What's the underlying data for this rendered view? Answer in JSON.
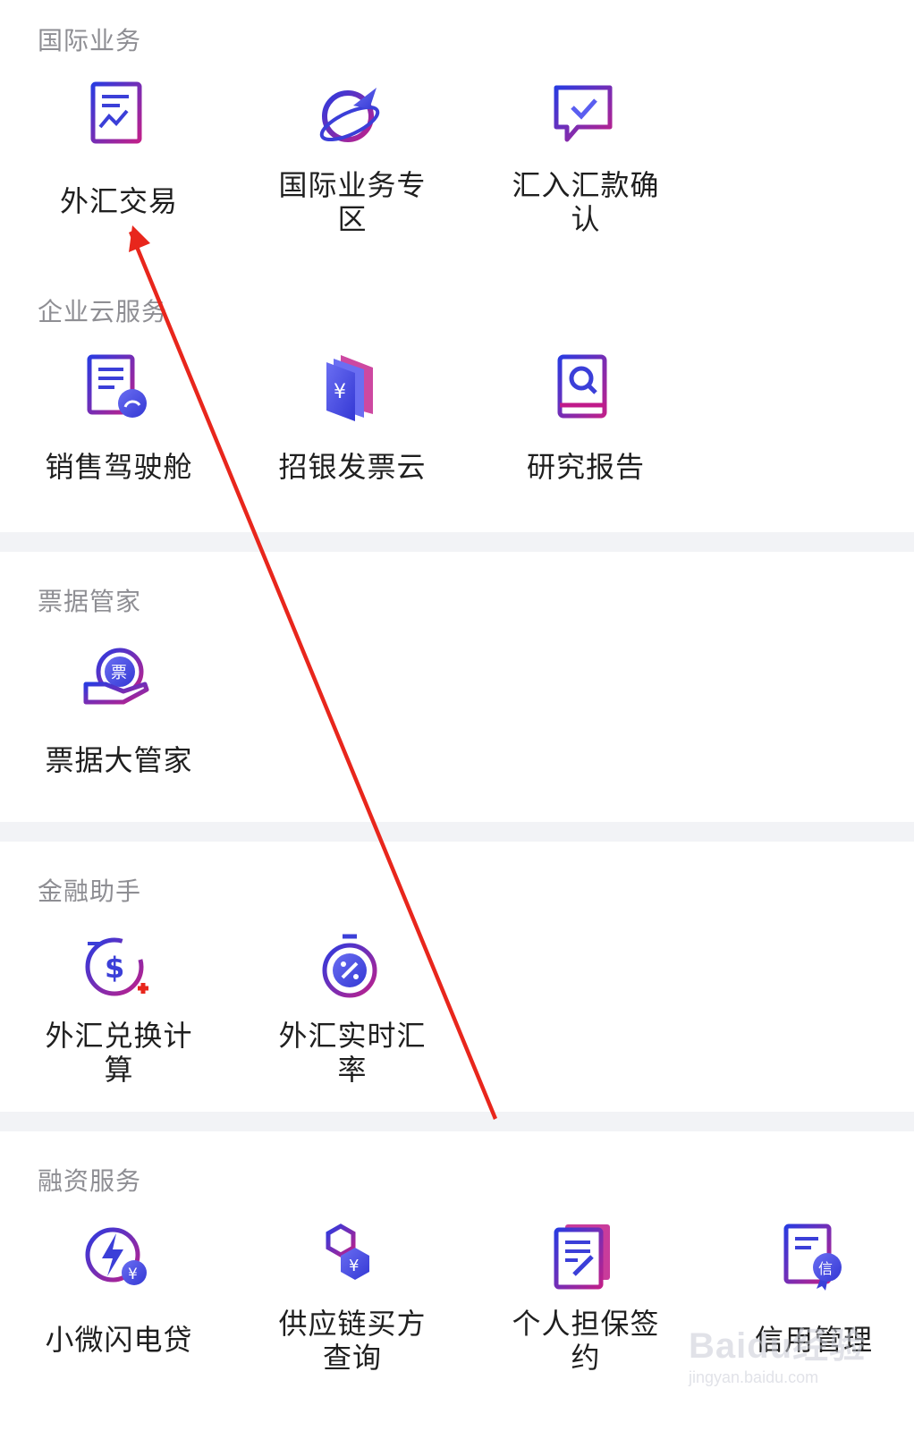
{
  "sections": [
    {
      "title": "国际业务",
      "items": [
        {
          "label": "外汇交易",
          "icon": "forex-trade-icon"
        },
        {
          "label": "国际业务专区",
          "icon": "globe-plane-icon"
        },
        {
          "label": "汇入汇款确认",
          "icon": "chat-check-icon"
        }
      ]
    },
    {
      "title": "企业云服务",
      "items": [
        {
          "label": "销售驾驶舱",
          "icon": "sales-dashboard-icon"
        },
        {
          "label": "招银发票云",
          "icon": "invoice-book-icon"
        },
        {
          "label": "研究报告",
          "icon": "research-book-icon"
        }
      ]
    },
    {
      "title": "票据管家",
      "items": [
        {
          "label": "票据大管家",
          "icon": "bill-hand-icon",
          "badge": "票"
        }
      ]
    },
    {
      "title": "金融助手",
      "items": [
        {
          "label": "外汇兑换计算",
          "icon": "currency-calc-icon"
        },
        {
          "label": "外汇实时汇率",
          "icon": "rate-timer-icon"
        }
      ]
    },
    {
      "title": "融资服务",
      "items": [
        {
          "label": "小微闪电贷",
          "icon": "lightning-loan-icon"
        },
        {
          "label": "供应链买方查询",
          "icon": "supply-chain-icon"
        },
        {
          "label": "个人担保签约",
          "icon": "guarantee-sign-icon"
        },
        {
          "label": "信用管理",
          "icon": "credit-manage-icon",
          "badge": "信"
        }
      ]
    }
  ],
  "watermark": {
    "brand": "Baidu经验",
    "url": "jingyan.baidu.com"
  },
  "colors": {
    "accent_blue": "#3b3fd8",
    "accent_magenta": "#c01a8a",
    "annotation_red": "#e8261c",
    "section_gap": "#f2f3f6"
  }
}
